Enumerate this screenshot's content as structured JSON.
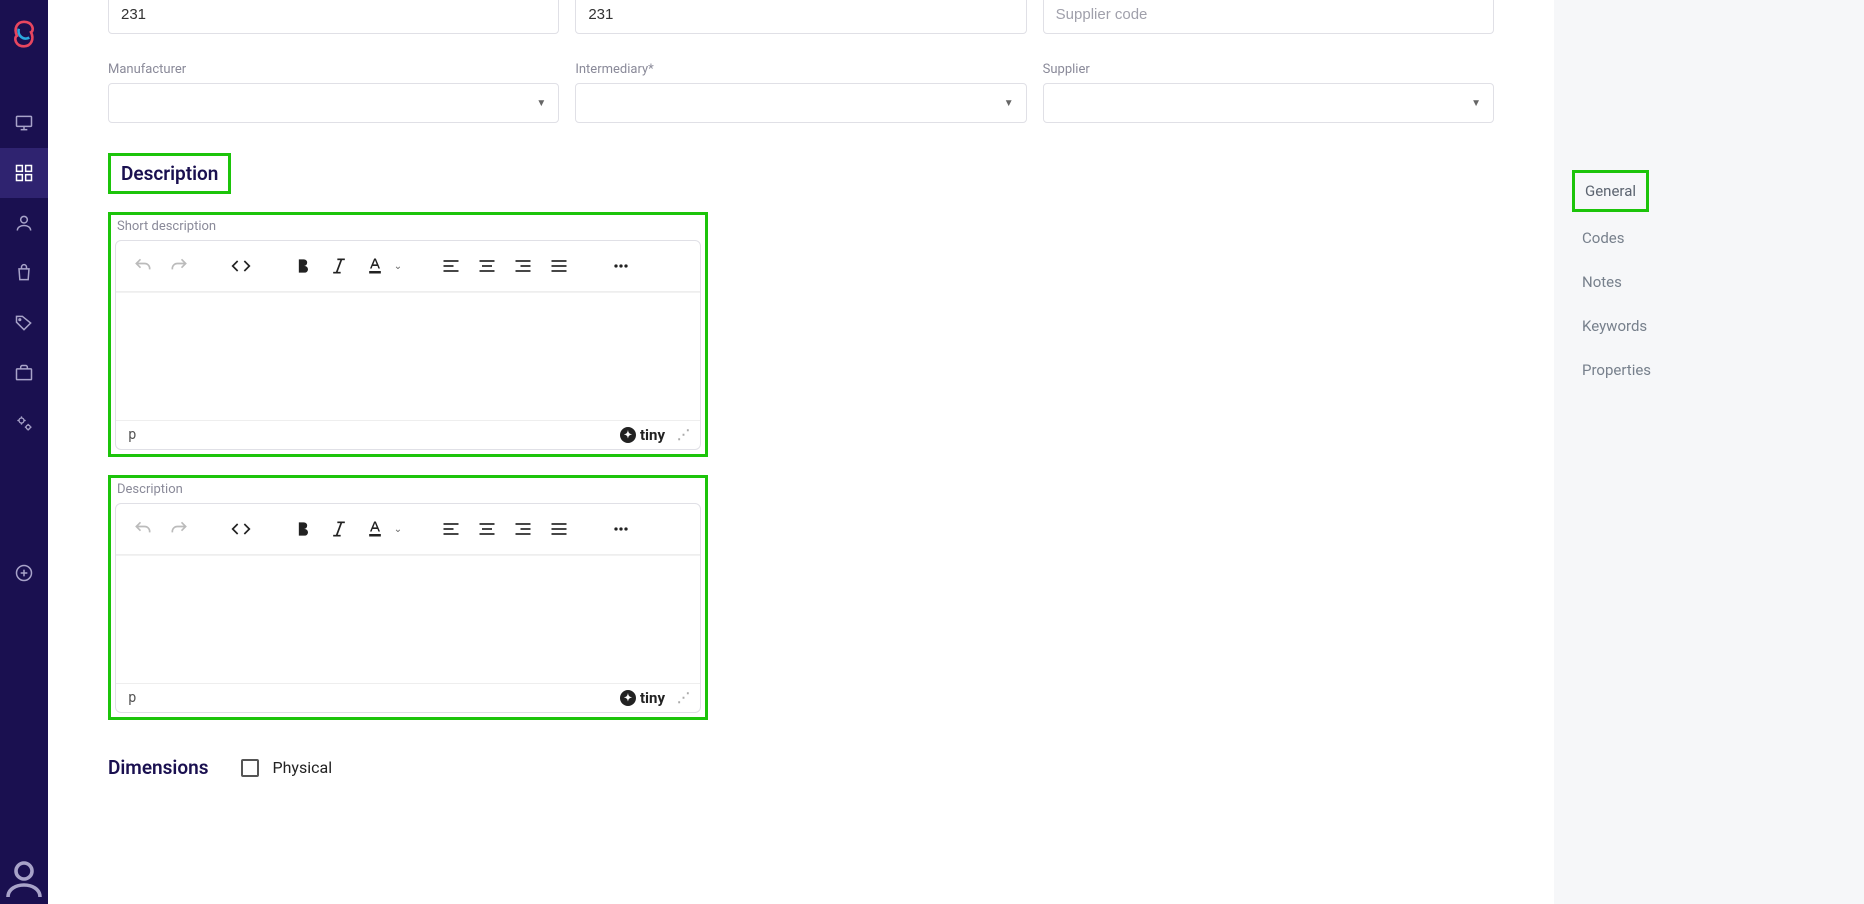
{
  "inputs": {
    "code1": "231",
    "code2": "231",
    "supplier_code_placeholder": "Supplier code"
  },
  "labels": {
    "manufacturer": "Manufacturer",
    "intermediary": "Intermediary*",
    "supplier": "Supplier",
    "short_description": "Short description",
    "description": "Description"
  },
  "sections": {
    "description": "Description",
    "dimensions": "Dimensions"
  },
  "editor": {
    "path": "p",
    "brand": "tiny"
  },
  "dimensions": {
    "physical": "Physical"
  },
  "right_panel": {
    "general": "General",
    "codes": "Codes",
    "notes": "Notes",
    "keywords": "Keywords",
    "properties": "Properties"
  }
}
